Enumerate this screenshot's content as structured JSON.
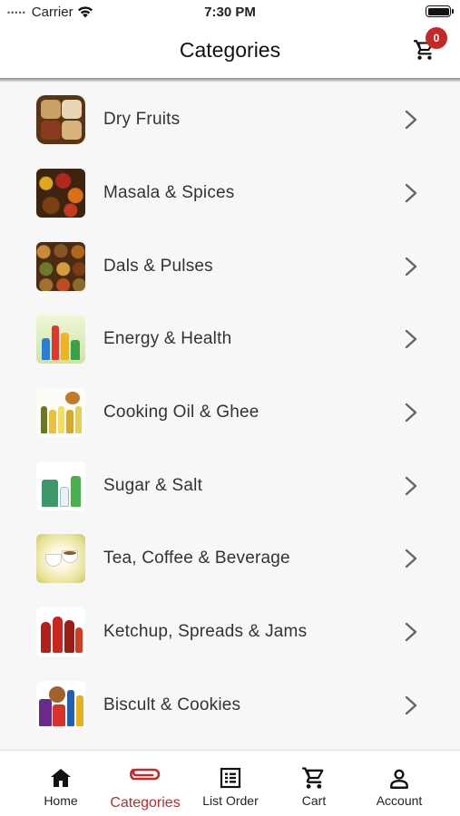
{
  "status_bar": {
    "carrier": "Carrier",
    "time": "7:30 PM"
  },
  "header": {
    "title": "Categories",
    "cart_badge_count": "0"
  },
  "categories": [
    {
      "label": "Dry Fruits",
      "icon": "dry-fruits-thumbnail"
    },
    {
      "label": "Masala & Spices",
      "icon": "masala-spices-thumbnail"
    },
    {
      "label": "Dals & Pulses",
      "icon": "dals-pulses-thumbnail"
    },
    {
      "label": "Energy & Health",
      "icon": "energy-health-thumbnail"
    },
    {
      "label": "Cooking Oil & Ghee",
      "icon": "cooking-oil-ghee-thumbnail"
    },
    {
      "label": "Sugar & Salt",
      "icon": "sugar-salt-thumbnail"
    },
    {
      "label": "Tea, Coffee & Beverage",
      "icon": "tea-coffee-beverage-thumbnail"
    },
    {
      "label": "Ketchup, Spreads & Jams",
      "icon": "ketchup-spreads-jams-thumbnail"
    },
    {
      "label": "Biscult & Cookies",
      "icon": "biscuit-cookies-thumbnail"
    }
  ],
  "bottom_nav": {
    "items": [
      {
        "label": "Home",
        "icon": "home-icon"
      },
      {
        "label": "Categories",
        "icon": "paperclip-icon",
        "active": true
      },
      {
        "label": "List Order",
        "icon": "list-order-icon"
      },
      {
        "label": "Cart",
        "icon": "cart-icon"
      },
      {
        "label": "Account",
        "icon": "account-icon"
      }
    ]
  },
  "colors": {
    "accent": "#c62828",
    "background": "#f7f7f7",
    "text": "#333333"
  }
}
